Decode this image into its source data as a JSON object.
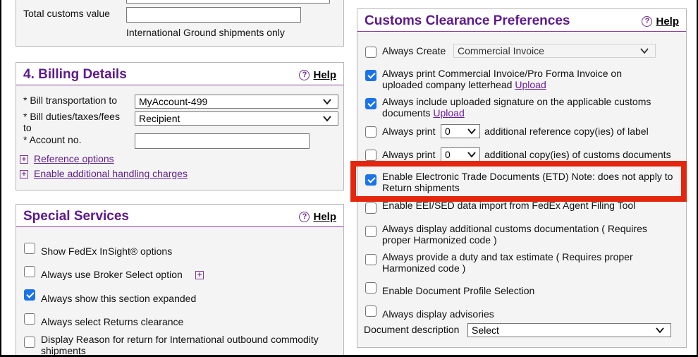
{
  "top_panel": {
    "customs_value_label": "Total customs value",
    "customs_value_input": "",
    "ground_note": "International Ground shipments only"
  },
  "billing": {
    "title": "4. Billing Details",
    "help": "Help",
    "bill_transport_label": "* Bill transportation to",
    "bill_transport_value": "MyAccount-499",
    "bill_duties_label": "* Bill duties/taxes/fees to",
    "bill_duties_value": "Recipient",
    "account_label": "* Account no.",
    "account_value": "",
    "reference_options": "Reference options",
    "handling_charges": "Enable additional handling charges"
  },
  "special": {
    "title": "Special Services",
    "help": "Help",
    "items": [
      {
        "label": "Show FedEx InSight® options",
        "checked": false
      },
      {
        "label": "Always use Broker Select option",
        "checked": false
      },
      {
        "label": "Always show this section expanded",
        "checked": true
      },
      {
        "label": "Always select Returns clearance",
        "checked": false
      },
      {
        "label": "Display Reason for return for International outbound commodity shipments",
        "checked": false
      }
    ]
  },
  "customs": {
    "title": "Customs Clearance Preferences",
    "help": "Help",
    "always_create_label": "Always Create",
    "always_create_value": "Commercial Invoice",
    "print_invoice_label": "Always print Commercial Invoice/Pro Forma Invoice on uploaded company letterhead",
    "upload_1": "Upload",
    "include_signature_label": "Always include uploaded signature on the applicable customs documents",
    "upload_2": "Upload",
    "print_ref_prefix": "Always print",
    "print_ref_count": "0",
    "print_ref_suffix": "additional reference copy(ies) of label",
    "print_copy_prefix": "Always print",
    "print_copy_count": "0",
    "print_copy_suffix": "additional copy(ies) of customs documents",
    "etd_label": "Enable Electronic Trade Documents (ETD) Note: does not apply to Return shipments",
    "eei_label": "Enable EEI/SED data import from FedEx Agent Filing Tool",
    "display_docs_label": "Always display additional customs documentation ( Requires proper Harmonized code )",
    "duty_estimate_label": "Always provide a duty and tax estimate ( Requires proper Harmonized code )",
    "doc_profile_label": "Enable Document Profile Selection",
    "advisories_label": "Always display advisories",
    "doc_desc_label": "Document description",
    "doc_desc_value": "Select"
  },
  "colors": {
    "accent": "#5d1a8c",
    "highlight": "#e3260d",
    "checkbox": "#1a73e8"
  }
}
